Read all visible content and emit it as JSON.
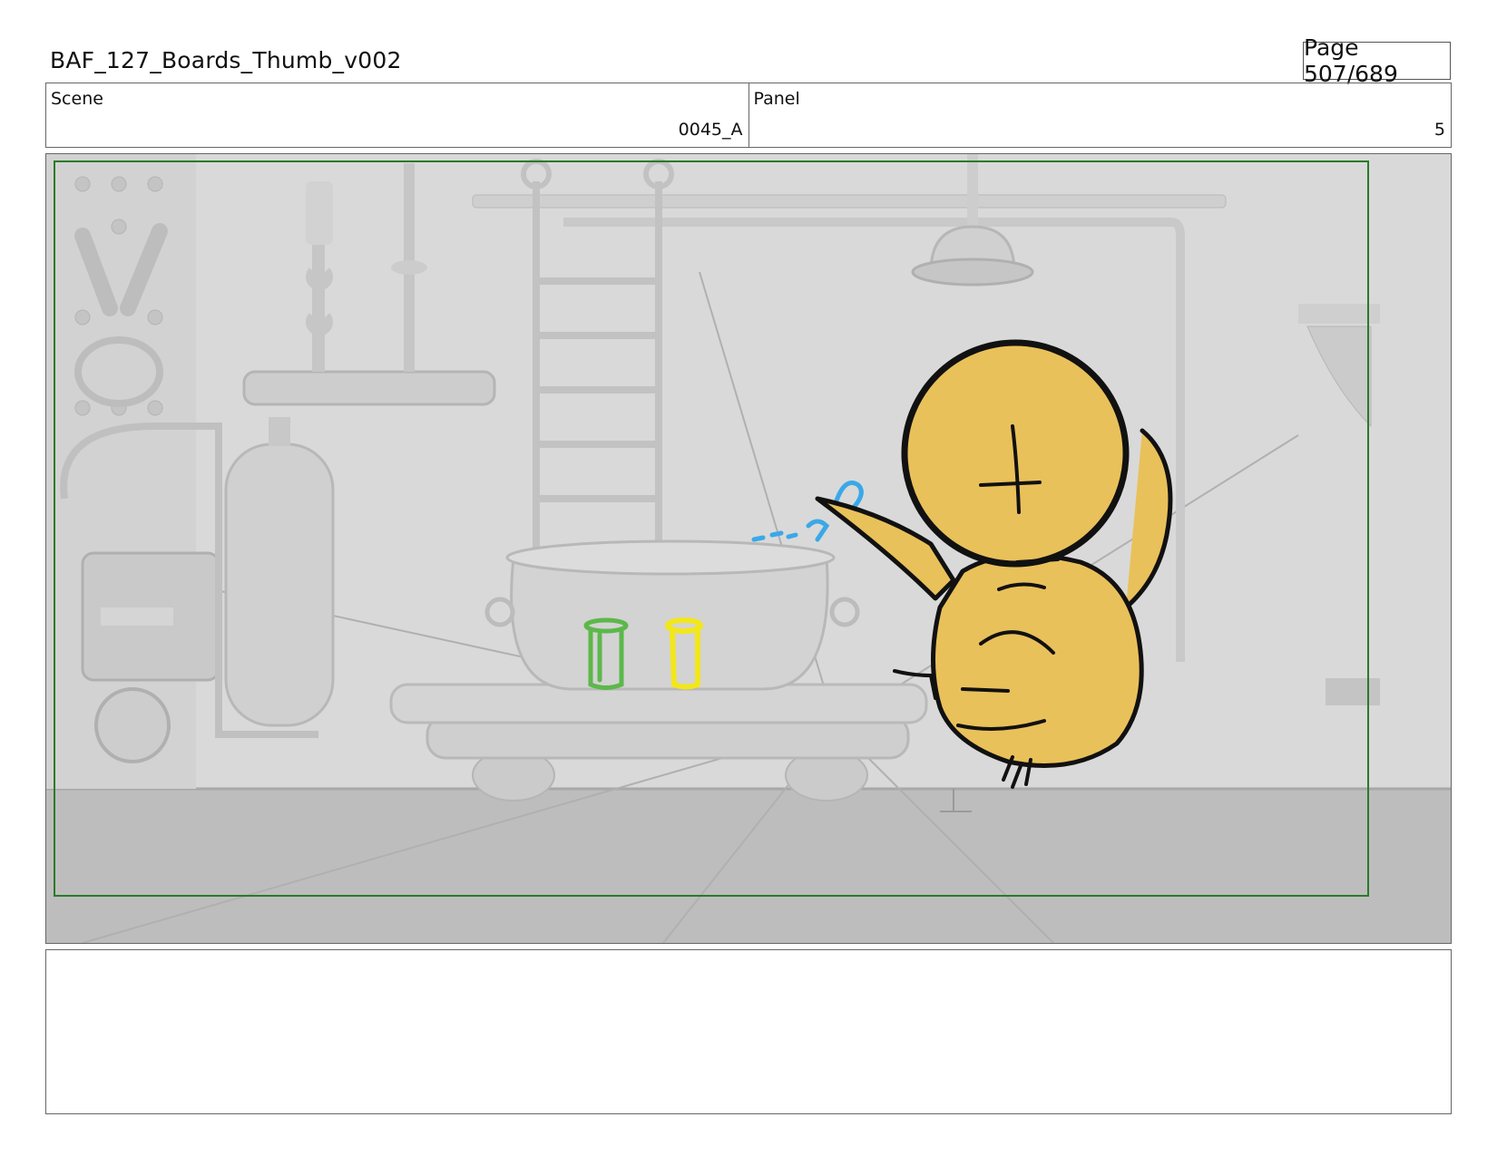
{
  "header": {
    "document_title": "BAF_127_Boards_Thumb_v002",
    "page_label": "Page 507/689"
  },
  "info": {
    "scene_label": "Scene",
    "scene_value": "0045_A",
    "panel_label": "Panel",
    "panel_value": "5"
  },
  "panel_image": {
    "safe_frame_color": "#2a7a2a",
    "character_color": "#e9c15a",
    "splash_color": "#3aa8e8",
    "vial_left_color": "#5cb84a",
    "vial_right_color": "#f2e61c"
  },
  "notes": {
    "text": ""
  }
}
